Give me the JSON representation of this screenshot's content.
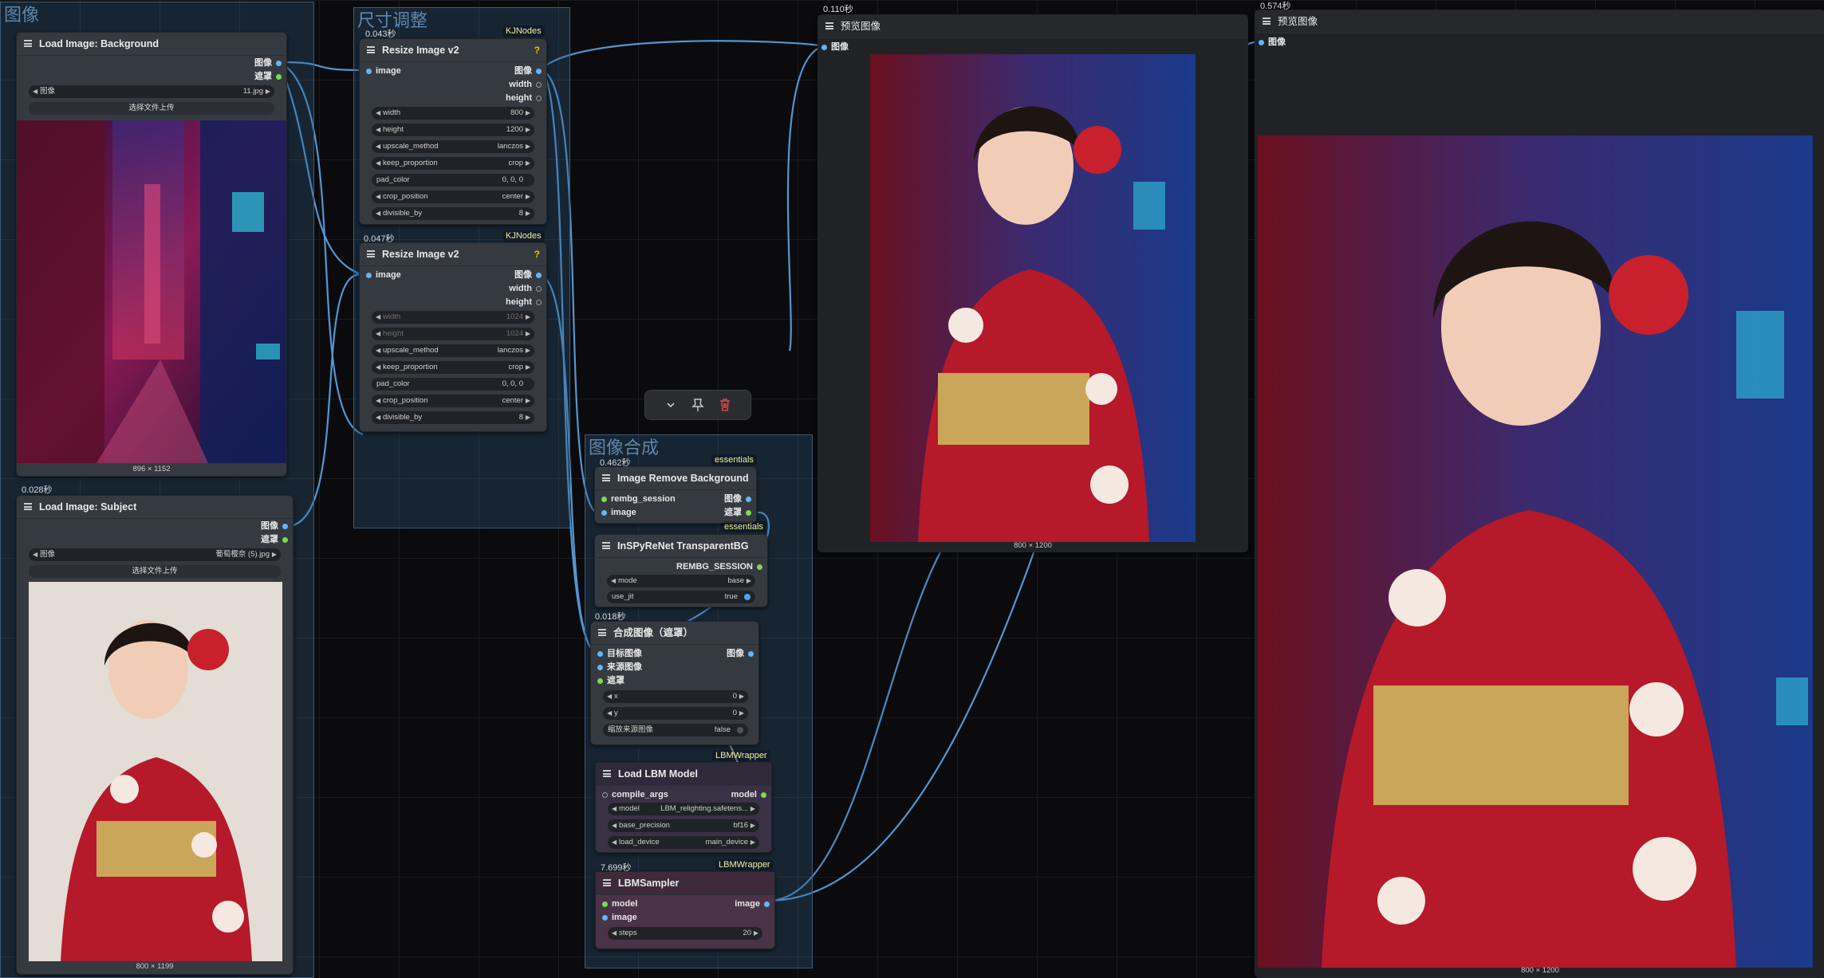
{
  "colors": {
    "wire": "#5aa7e8",
    "group": "#3c5a78",
    "node": "#343a40",
    "badge": "#f0f0a0"
  },
  "groups": {
    "image": "图像",
    "resize": "尺寸调整",
    "compose": "图像合成"
  },
  "bg_loader": {
    "title": "Load Image: Background",
    "out_image": "图像",
    "out_mask": "遮罩",
    "image_label": "图像",
    "image_value": "11.jpg",
    "upload": "选择文件上传",
    "caption": "896 × 1152"
  },
  "subject_loader": {
    "timing": "0.028秒",
    "title": "Load Image: Subject",
    "out_image": "图像",
    "out_mask": "遮罩",
    "image_label": "图像",
    "image_value": "葡萄樱奈 (5).jpg",
    "upload": "选择文件上传",
    "caption": "800 × 1199"
  },
  "resize1": {
    "timing": "0.043秒",
    "badge": "KJNodes",
    "title": "Resize Image v2",
    "help": "?",
    "in_image": "image",
    "out_image": "图像",
    "out_width": "width",
    "out_height": "height",
    "widgets": [
      {
        "l": "width",
        "v": "800"
      },
      {
        "l": "height",
        "v": "1200"
      },
      {
        "l": "upscale_method",
        "v": "lanczos"
      },
      {
        "l": "keep_proportion",
        "v": "crop"
      },
      {
        "l": "pad_color",
        "v": "0, 0, 0"
      },
      {
        "l": "crop_position",
        "v": "center"
      },
      {
        "l": "divisible_by",
        "v": "8"
      }
    ]
  },
  "resize2": {
    "timing": "0.047秒",
    "badge": "KJNodes",
    "title": "Resize Image v2",
    "help": "?",
    "in_image": "image",
    "out_image": "图像",
    "out_width": "width",
    "out_height": "height",
    "widgets": [
      {
        "l": "width",
        "v": "1024"
      },
      {
        "l": "height",
        "v": "1024"
      },
      {
        "l": "upscale_method",
        "v": "lanczos"
      },
      {
        "l": "keep_proportion",
        "v": "crop"
      },
      {
        "l": "pad_color",
        "v": "0, 0, 0"
      },
      {
        "l": "crop_position",
        "v": "center"
      },
      {
        "l": "divisible_by",
        "v": "8"
      }
    ]
  },
  "remove_bg": {
    "timing": "0.462秒",
    "badge": "essentials",
    "title": "Image Remove Background",
    "in_session": "rembg_session",
    "in_image": "image",
    "out_image": "图像",
    "out_mask": "遮罩"
  },
  "inspyrenet": {
    "badge": "essentials",
    "title": "InSPyReNet TransparentBG",
    "out_session": "REMBG_SESSION",
    "mode_label": "mode",
    "mode_value": "base",
    "jit_label": "use_jit",
    "jit_value": "true"
  },
  "composite": {
    "timing": "0.018秒",
    "title": "合成图像（遮罩）",
    "in_dest": "目标图像",
    "in_source": "来源图像",
    "in_mask": "遮罩",
    "out_image": "图像",
    "x_label": "x",
    "x_value": "0",
    "y_label": "y",
    "y_value": "0",
    "resize_label": "缩放来源图像",
    "resize_value": "false"
  },
  "lbm_model": {
    "badge": "LBMWrapper",
    "title": "Load LBM Model",
    "in_compile": "compile_args",
    "out_model": "model",
    "model_label": "model",
    "model_value": "LBM_relighting.safetens...",
    "precision_label": "base_precision",
    "precision_value": "bf16",
    "device_label": "load_device",
    "device_value": "main_device"
  },
  "lbm_sampler": {
    "timing": "7.699秒",
    "badge": "LBMWrapper",
    "title": "LBMSampler",
    "in_model": "model",
    "in_image": "image",
    "out_image": "image",
    "steps_label": "steps",
    "steps_value": "20"
  },
  "preview1": {
    "timing": "0.110秒",
    "title": "预览图像",
    "in_image": "图像",
    "caption": "800 × 1200"
  },
  "preview2": {
    "timing": "0.574秒",
    "title": "预览图像",
    "in_image": "图像",
    "caption": "800 × 1200"
  },
  "toolbar": {
    "icons": [
      "chevron-down-icon",
      "pin-icon",
      "trash-icon"
    ]
  }
}
